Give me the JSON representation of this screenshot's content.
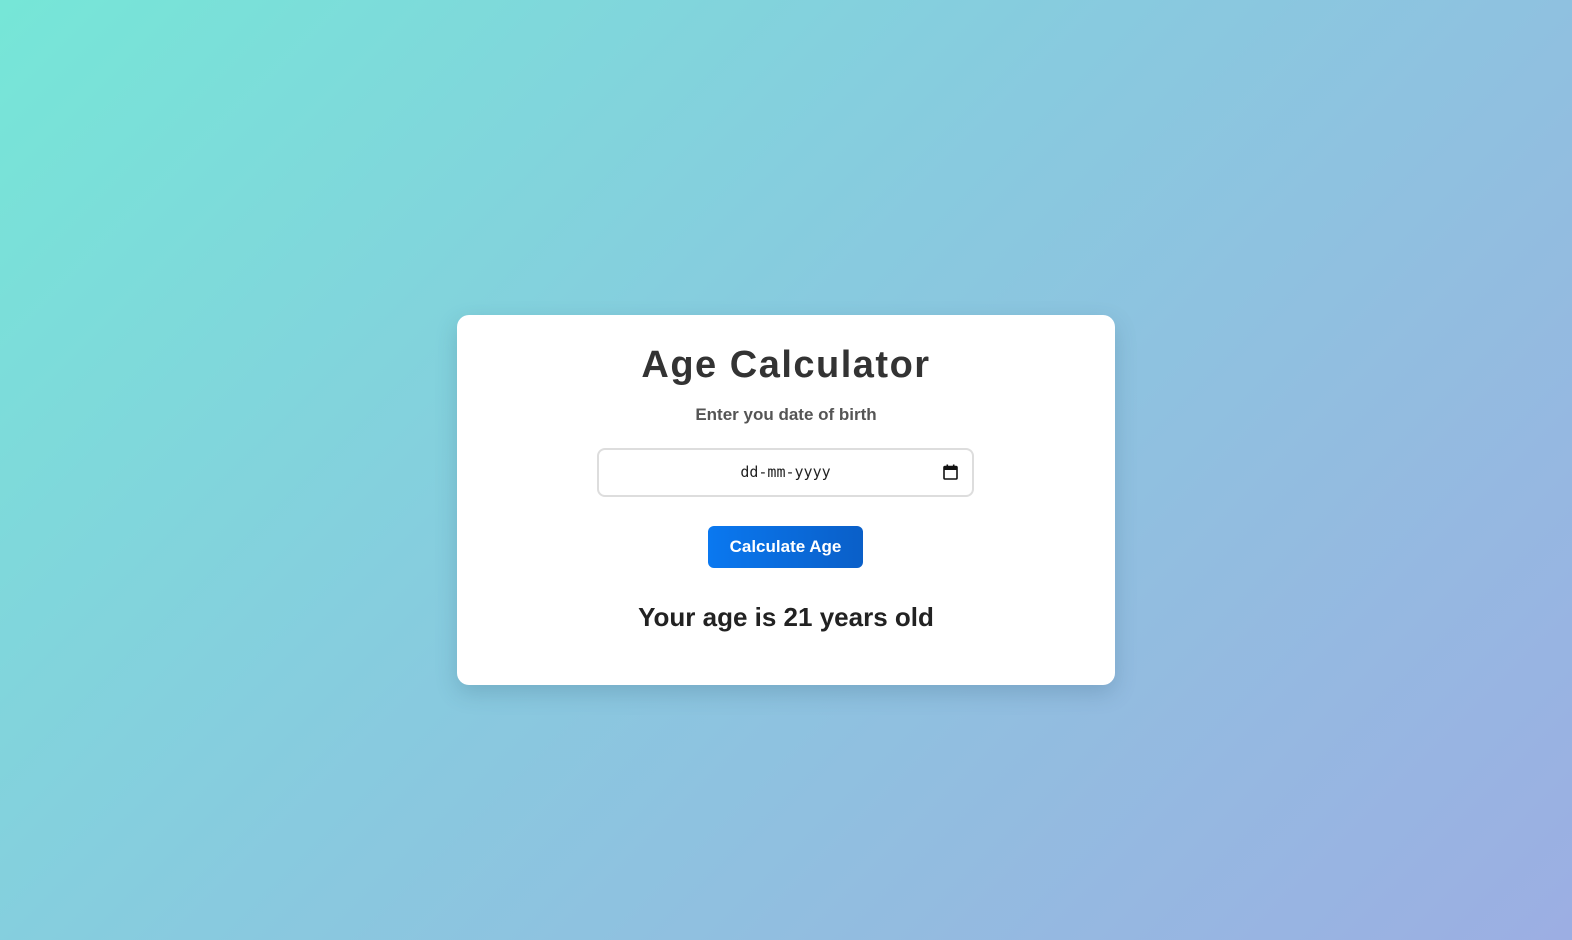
{
  "app": {
    "title": "Age Calculator",
    "subtitle": "Enter you date of birth"
  },
  "dob_input": {
    "value_display": "dd-mm-yyyy",
    "icon": "calendar-icon"
  },
  "calculate_button": {
    "label": "Calculate Age"
  },
  "result": {
    "text": "Your age is 21 years old"
  },
  "colors": {
    "button": "#0a6ee0",
    "title": "#333333",
    "background_start": "#76e6d7",
    "background_end": "#9caee3"
  }
}
